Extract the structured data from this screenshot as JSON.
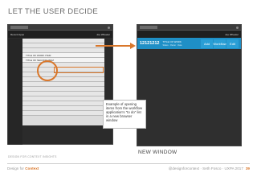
{
  "slide": {
    "title": "LET THE USER DECIDE",
    "new_window_label": "NEW WINDOW",
    "copyright": "DESIGN FOR CONTEXT INSIGHTS",
    "footer": {
      "brand_prefix": "Design for",
      "brand_word": "Context",
      "credit": "@designforcontext · Seth Fosco · UXPA 2017",
      "page_number": "39"
    },
    "note": "Example of opening items from the workflow application's \"to do\" list in a new browser window"
  },
  "left_screen": {
    "app_title": "Recent Apps",
    "user": "Joe Wheeler",
    "rows": [
      "",
      "",
      "",
      "TITLE OF WORK ITEM",
      "TITLE OF SECOND ITEM",
      "",
      "",
      "",
      "",
      "",
      "",
      "",
      "",
      "",
      "",
      ""
    ]
  },
  "right_screen": {
    "user": "Joe Wheeler",
    "record": {
      "id": "12121212",
      "title": "TITLE OF WORK",
      "subtitle": "Status · Owner · Date"
    },
    "actions": [
      "Add",
      "Workflow",
      "Edit"
    ]
  },
  "colors": {
    "accent": "#d9772b",
    "record_blue": "#1f8fc6",
    "dark_bg": "#2f2f2f"
  }
}
